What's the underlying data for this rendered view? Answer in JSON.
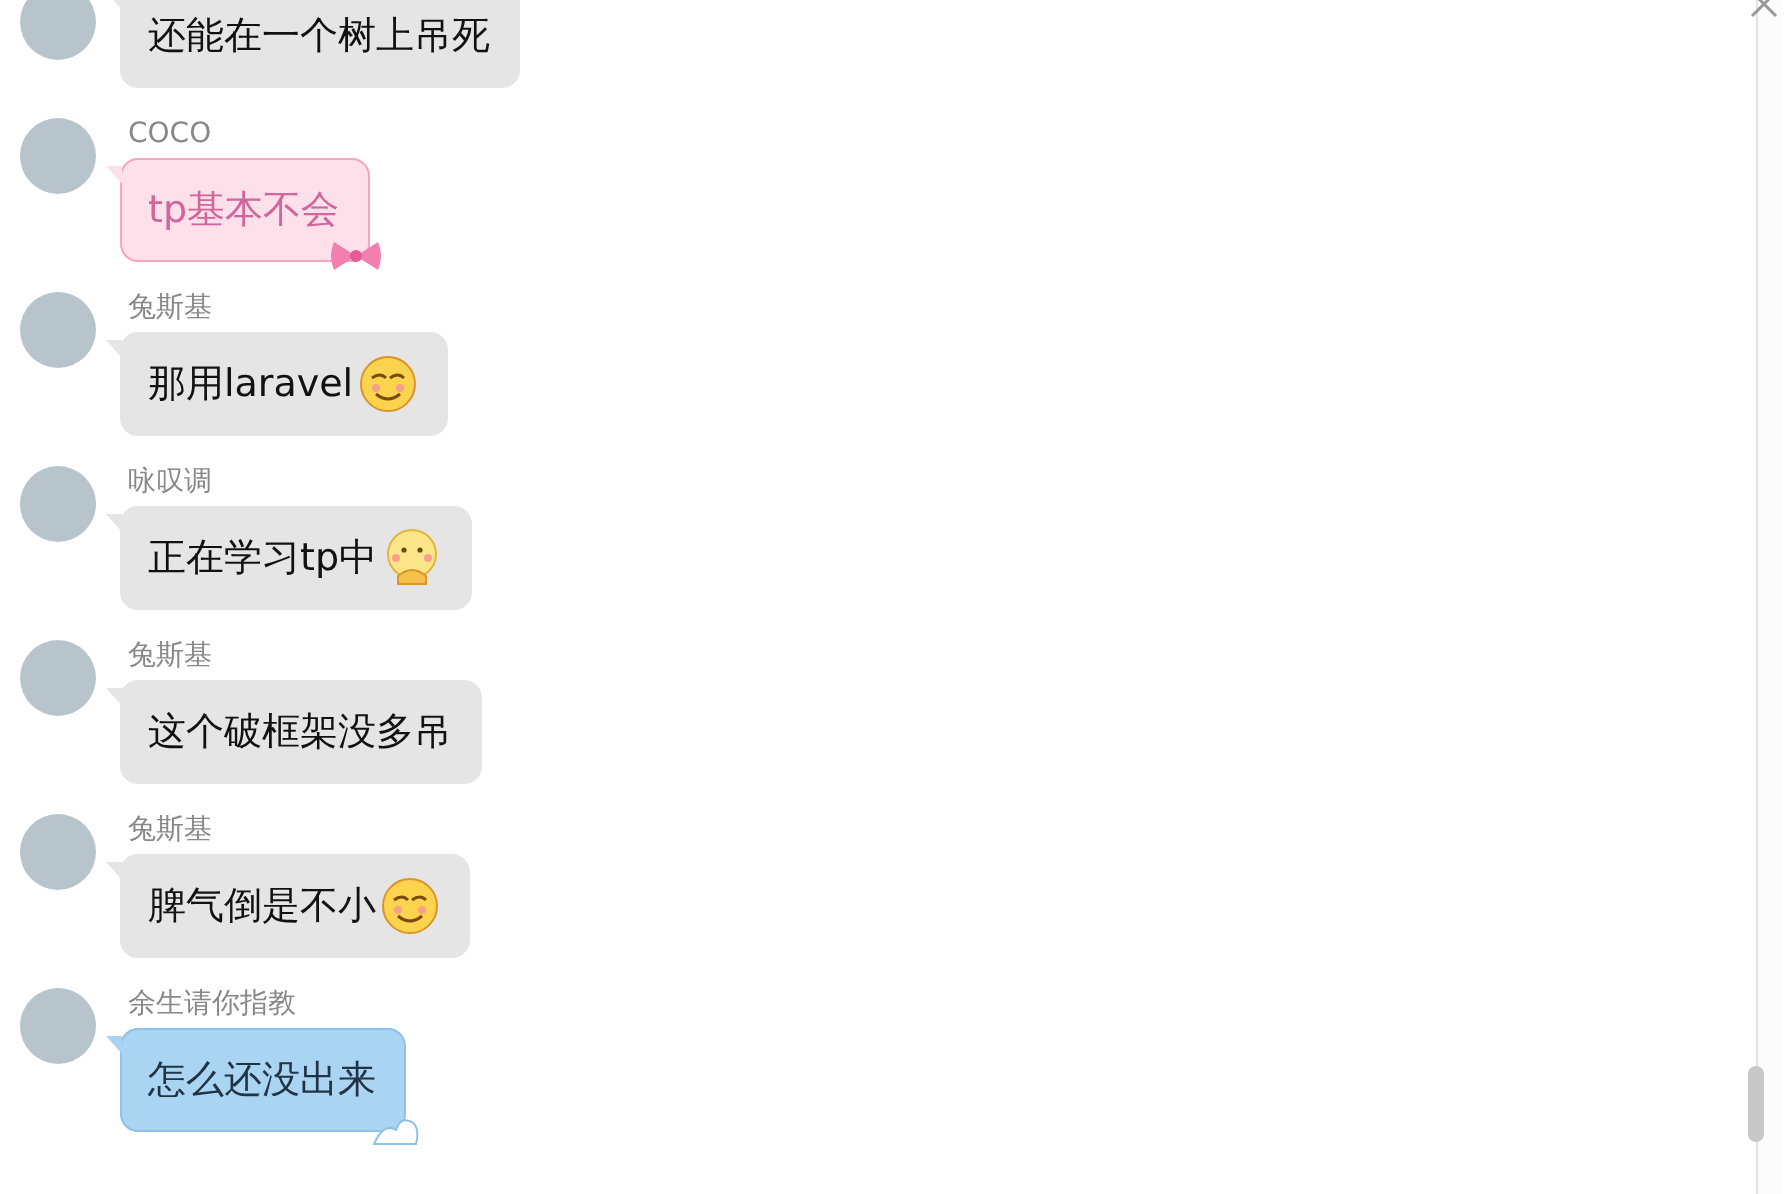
{
  "messages": [
    {
      "kind": "plain",
      "text": "还能在一个树上吊死"
    },
    {
      "sender": "COCO",
      "kind": "pink",
      "text": "tp基本不会"
    },
    {
      "sender": "兔斯基",
      "kind": "plain",
      "text": "那用laravel",
      "emojis": [
        {
          "kind": "smirk"
        }
      ]
    },
    {
      "sender": "咏叹调",
      "kind": "plain",
      "text": "正在学习tp中",
      "emojis": [
        {
          "kind": "think"
        }
      ]
    },
    {
      "sender": "兔斯基",
      "kind": "plain",
      "text": "这个破框架没多吊"
    },
    {
      "sender": "兔斯基",
      "kind": "plain",
      "text": "脾气倒是不小",
      "emojis": [
        {
          "kind": "smirk"
        }
      ]
    },
    {
      "sender": "余生请你指教",
      "kind": "blue",
      "text": "怎么还没出来"
    }
  ]
}
